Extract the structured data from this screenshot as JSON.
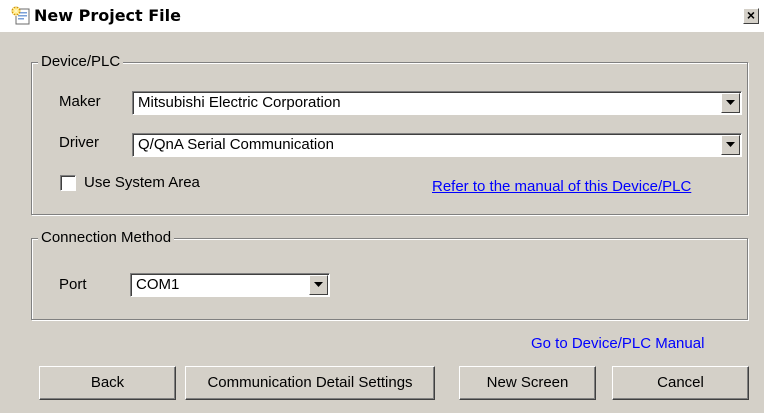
{
  "window": {
    "title": "New Project File",
    "close_glyph": "×",
    "icon": "new-project-icon"
  },
  "device_plc": {
    "group_title": "Device/PLC",
    "maker_label": "Maker",
    "maker_value": "Mitsubishi Electric Corporation",
    "driver_label": "Driver",
    "driver_value": "Q/QnA Serial Communication",
    "use_system_area_label": "Use System Area",
    "use_system_area_checked": false,
    "manual_link": "Refer to the manual of this Device/PLC"
  },
  "connection": {
    "group_title": "Connection Method",
    "port_label": "Port",
    "port_value": "COM1"
  },
  "footer": {
    "manual_link": "Go to Device/PLC Manual",
    "back_label": "Back",
    "comm_settings_label": "Communication Detail Settings",
    "new_screen_label": "New Screen",
    "cancel_label": "Cancel"
  },
  "colors": {
    "face": "#d4d0c8",
    "link": "#0000ff"
  }
}
